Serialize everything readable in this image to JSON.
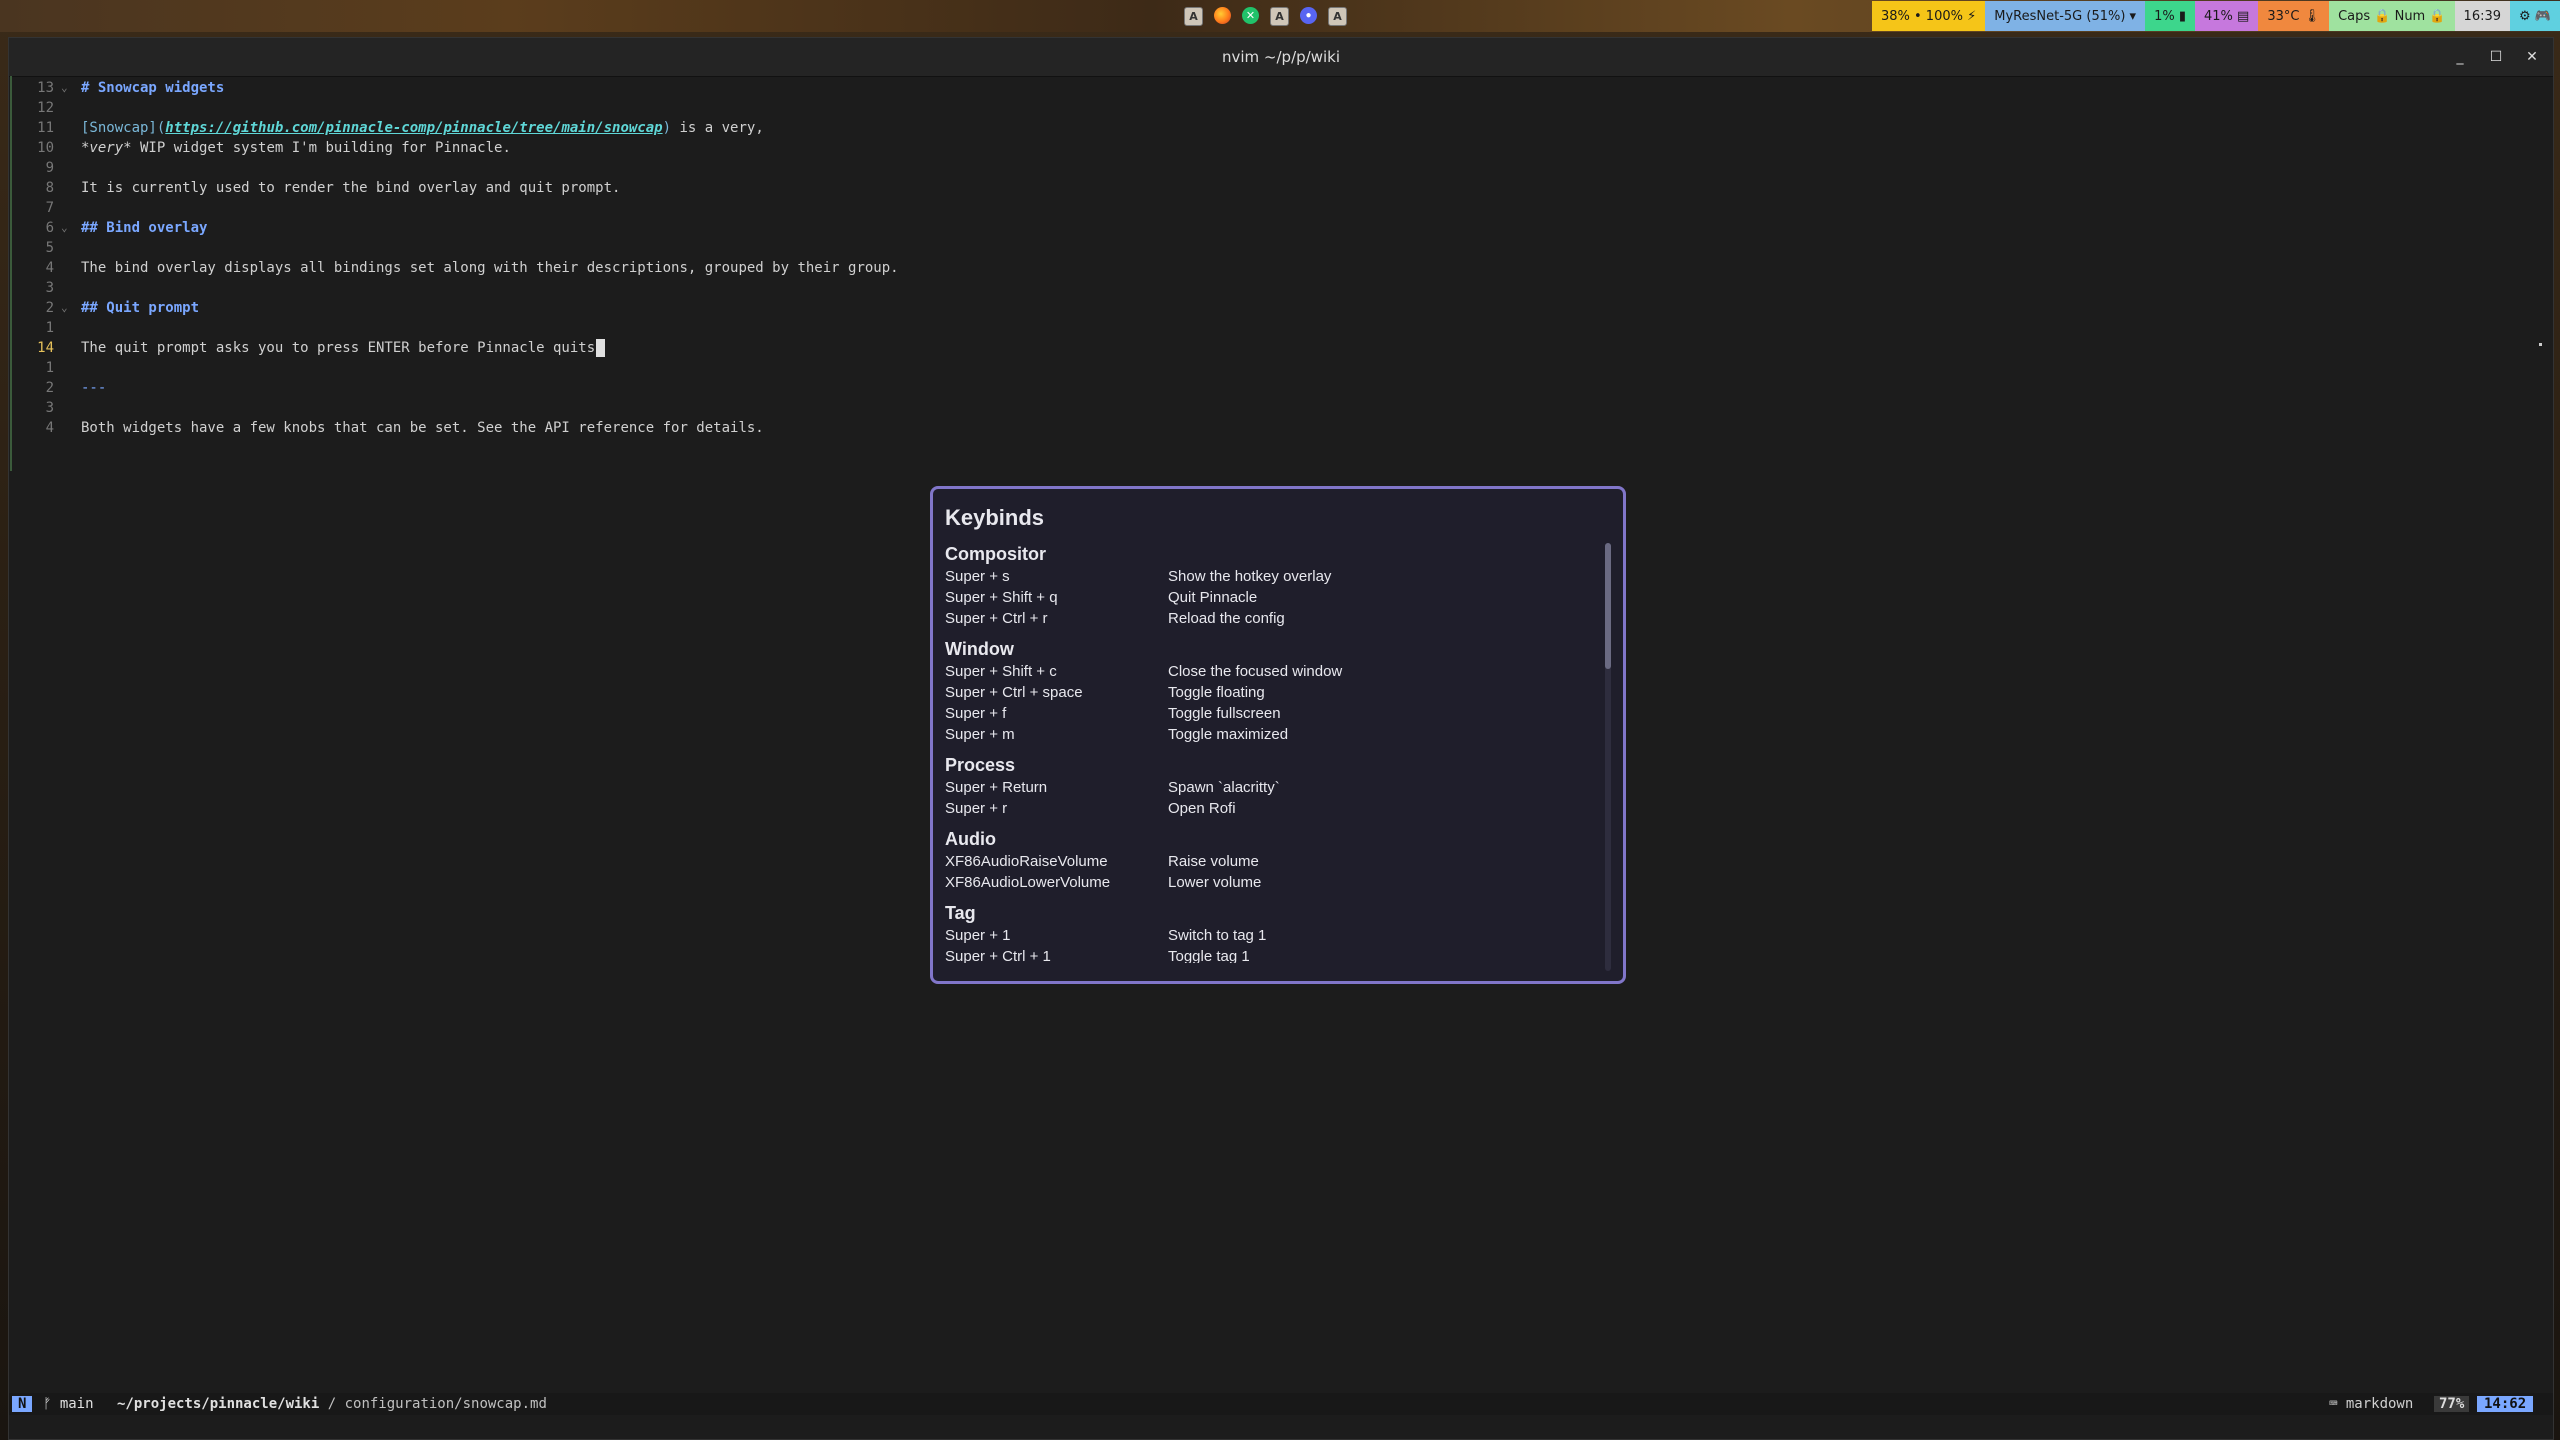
{
  "topbar": {
    "tray_icons": [
      {
        "name": "input-method-icon",
        "glyph": "A"
      },
      {
        "name": "firefox-icon",
        "glyph": ""
      },
      {
        "name": "xbox-icon",
        "glyph": "✕"
      },
      {
        "name": "input-method-icon",
        "glyph": "A"
      },
      {
        "name": "discord-icon",
        "glyph": "●"
      },
      {
        "name": "input-method-icon",
        "glyph": "A"
      }
    ],
    "pills": [
      {
        "name": "battery-pill",
        "text": "38% • 100% ⚡",
        "color": "#f5c518"
      },
      {
        "name": "network-pill",
        "text": "MyResNet-5G (51%) ▾",
        "color": "#7fb2e5"
      },
      {
        "name": "cpu-pill",
        "text": "1% ▮",
        "color": "#3dd68c"
      },
      {
        "name": "memory-pill",
        "text": "41% ▤",
        "color": "#c678dd"
      },
      {
        "name": "temperature-pill",
        "text": "33°C 🌡",
        "color": "#f0883e"
      },
      {
        "name": "lock-keys-pill",
        "text": "Caps 🔒  Num 🔒",
        "color": "#9fe29f"
      },
      {
        "name": "clock-pill",
        "text": "16:39",
        "color": "#d6d6d6"
      },
      {
        "name": "tray-extra-pill",
        "text": "⚙ 🎮",
        "color": "#5fd0e0"
      }
    ]
  },
  "window": {
    "title": "nvim ~/p/p/wiki",
    "minimize_glyph": "_",
    "maximize_glyph": "☐",
    "close_glyph": "✕"
  },
  "editor": {
    "lines": [
      {
        "ln": "13",
        "fold": "⌄",
        "type": "heading",
        "text": "# Snowcap widgets"
      },
      {
        "ln": "12",
        "fold": "",
        "type": "plain",
        "text": ""
      },
      {
        "ln": "11",
        "fold": "",
        "type": "link",
        "link_text": "[Snowcap]",
        "url_open": "(",
        "url": "https://github.com/pinnacle-comp/pinnacle/tree/main/snowcap",
        "url_close": ")",
        "after": " is a very,"
      },
      {
        "ln": "10",
        "fold": "",
        "type": "emph",
        "em": "*very*",
        "after": " WIP widget system I'm building for Pinnacle."
      },
      {
        "ln": "9",
        "fold": "",
        "type": "plain",
        "text": ""
      },
      {
        "ln": "8",
        "fold": "",
        "type": "plain",
        "text": "It is currently used to render the bind overlay and quit prompt."
      },
      {
        "ln": "7",
        "fold": "",
        "type": "plain",
        "text": ""
      },
      {
        "ln": "6",
        "fold": "⌄",
        "type": "heading",
        "text": "## Bind overlay"
      },
      {
        "ln": "5",
        "fold": "",
        "type": "plain",
        "text": ""
      },
      {
        "ln": "4",
        "fold": "",
        "type": "plain",
        "text": "The bind overlay displays all bindings set along with their descriptions, grouped by their group."
      },
      {
        "ln": "3",
        "fold": "",
        "type": "plain",
        "text": ""
      },
      {
        "ln": "2",
        "fold": "⌄",
        "type": "heading",
        "text": "## Quit prompt"
      },
      {
        "ln": "1",
        "fold": "",
        "type": "plain",
        "text": ""
      },
      {
        "ln": "14",
        "fold": "",
        "type": "cursor",
        "text": "The quit prompt asks you to press ENTER before Pinnacle quits",
        "cursor_char": "."
      },
      {
        "ln": "1",
        "fold": "",
        "type": "plain",
        "text": ""
      },
      {
        "ln": "2",
        "fold": "",
        "type": "hr",
        "text": "---"
      },
      {
        "ln": "3",
        "fold": "",
        "type": "plain",
        "text": ""
      },
      {
        "ln": "4",
        "fold": "",
        "type": "plain",
        "text": "Both widgets have a few knobs that can be set. See the API reference for details."
      }
    ]
  },
  "statusline": {
    "mode": "N",
    "branch": "ᚠ main",
    "path_bold": "~/projects/pinnacle/wiki",
    "path_rest": " / configuration/snowcap.md",
    "filetype": "⌨ markdown",
    "percent": "77%",
    "position": "14:62"
  },
  "overlay": {
    "title": "Keybinds",
    "groups": [
      {
        "title": "Compositor",
        "binds": [
          {
            "key": "Super + s",
            "desc": "Show the hotkey overlay"
          },
          {
            "key": "Super + Shift + q",
            "desc": "Quit Pinnacle"
          },
          {
            "key": "Super + Ctrl + r",
            "desc": "Reload the config"
          }
        ]
      },
      {
        "title": "Window",
        "binds": [
          {
            "key": "Super + Shift + c",
            "desc": "Close the focused window"
          },
          {
            "key": "Super + Ctrl + space",
            "desc": "Toggle floating"
          },
          {
            "key": "Super + f",
            "desc": "Toggle fullscreen"
          },
          {
            "key": "Super + m",
            "desc": "Toggle maximized"
          }
        ]
      },
      {
        "title": "Process",
        "binds": [
          {
            "key": "Super + Return",
            "desc": "Spawn `alacritty`"
          },
          {
            "key": "Super + r",
            "desc": "Open Rofi"
          }
        ]
      },
      {
        "title": "Audio",
        "binds": [
          {
            "key": "XF86AudioRaiseVolume",
            "desc": "Raise volume"
          },
          {
            "key": "XF86AudioLowerVolume",
            "desc": "Lower volume"
          }
        ]
      },
      {
        "title": "Tag",
        "binds": [
          {
            "key": "Super + 1",
            "desc": "Switch to tag 1"
          },
          {
            "key": "Super + Ctrl + 1",
            "desc": "Toggle tag 1"
          }
        ]
      }
    ]
  },
  "colors": {
    "overlay_border": "#8176c9",
    "overlay_bg": "#1f1e2b",
    "heading": "#7aa7ff",
    "url": "#5fd7d7",
    "cursor_line_number": "#e6c15a"
  }
}
